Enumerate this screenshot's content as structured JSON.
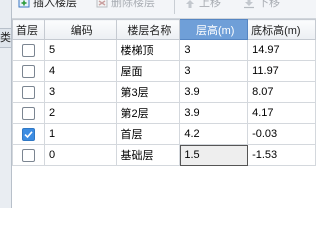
{
  "left_panel": {
    "tab_label": "类"
  },
  "toolbar": {
    "insert_label": "插入楼层",
    "delete_label": "删除楼层",
    "up_label": "上移",
    "down_label": "下移"
  },
  "table": {
    "columns": [
      "首层",
      "编码",
      "楼层名称",
      "层高(m)",
      "底标高(m)"
    ],
    "selected_column": "层高(m)",
    "rows": [
      {
        "first": false,
        "code": "5",
        "name": "楼梯顶",
        "height": "3",
        "elevation": "14.97"
      },
      {
        "first": false,
        "code": "4",
        "name": "屋面",
        "height": "3",
        "elevation": "11.97"
      },
      {
        "first": false,
        "code": "3",
        "name": "第3层",
        "height": "3.9",
        "elevation": "8.07"
      },
      {
        "first": false,
        "code": "2",
        "name": "第2层",
        "height": "3.9",
        "elevation": "4.17"
      },
      {
        "first": true,
        "code": "1",
        "name": "首层",
        "height": "4.2",
        "elevation": "-0.03"
      },
      {
        "first": false,
        "code": "0",
        "name": "基础层",
        "height": "1.5",
        "elevation": "-1.53"
      }
    ]
  },
  "colors": {
    "selected_header": "#6f9fd8",
    "checkbox_checked": "#3c8ce2",
    "disabled_text": "#a9adb3"
  }
}
